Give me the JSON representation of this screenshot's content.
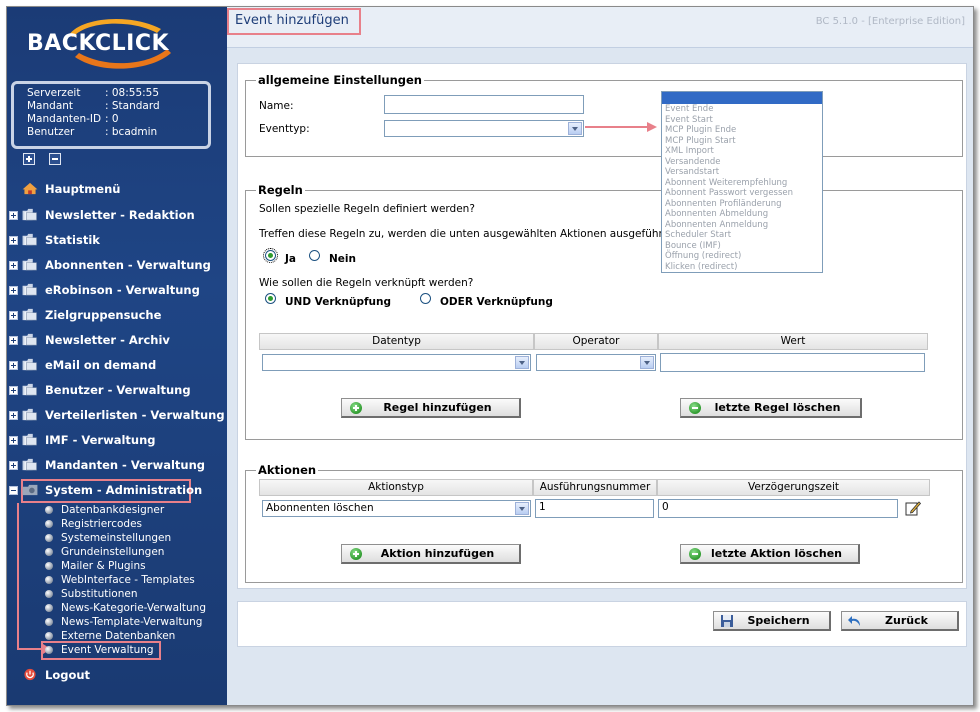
{
  "brand": {
    "logo_text": "BACKCLICK"
  },
  "info": {
    "rows": [
      {
        "key": "Serverzeit",
        "value": ": 08:55:55"
      },
      {
        "key": "Mandant",
        "value": ": Standard"
      },
      {
        "key": "Mandanten-ID",
        "value": ": 0"
      },
      {
        "key": "Benutzer",
        "value": ": bcadmin"
      }
    ]
  },
  "nav": {
    "items": [
      {
        "label": "Hauptmenü"
      },
      {
        "label": "Newsletter - Redaktion"
      },
      {
        "label": "Statistik"
      },
      {
        "label": "Abonnenten - Verwaltung"
      },
      {
        "label": "eRobinson - Verwaltung"
      },
      {
        "label": "Zielgruppensuche"
      },
      {
        "label": "Newsletter - Archiv"
      },
      {
        "label": "eMail on demand"
      },
      {
        "label": "Benutzer - Verwaltung"
      },
      {
        "label": "Verteilerlisten - Verwaltung"
      },
      {
        "label": "IMF - Verwaltung"
      },
      {
        "label": "Mandanten - Verwaltung"
      },
      {
        "label": "System - Administration"
      }
    ],
    "sub_items": [
      {
        "label": "Datenbankdesigner"
      },
      {
        "label": "Registriercodes"
      },
      {
        "label": "Systemeinstellungen"
      },
      {
        "label": "Grundeinstellungen"
      },
      {
        "label": "Mailer & Plugins"
      },
      {
        "label": "WebInterface - Templates"
      },
      {
        "label": "Substitutionen"
      },
      {
        "label": "News-Kategorie-Verwaltung"
      },
      {
        "label": "News-Template-Verwaltung"
      },
      {
        "label": "Externe Datenbanken"
      },
      {
        "label": "Event Verwaltung"
      }
    ],
    "logout": "Logout"
  },
  "header": {
    "title": "Event hinzufügen",
    "version": "BC 5.1.0 - [Enterprise Edition]"
  },
  "general": {
    "legend": "allgemeine Einstellungen",
    "name_label": "Name:",
    "name_value": "",
    "eventtype_label": "Eventtyp:",
    "eventtype_value": "",
    "eventtype_options": [
      "Event Ende",
      "Event Start",
      "MCP Plugin Ende",
      "MCP Plugin Start",
      "XML Import",
      "Versandende",
      "Versandstart",
      "Abonnent Weiterempfehlung",
      "Abonnent Passwort vergessen",
      "Abonnenten Profiländerung",
      "Abonnenten Abmeldung",
      "Abonnenten Anmeldung",
      "Scheduler Start",
      "Bounce (IMF)",
      "Öffnung (redirect)",
      "Klicken (redirect)"
    ]
  },
  "rules": {
    "legend": "Regeln",
    "question1": "Sollen spezielle Regeln definiert werden?",
    "info": "Treffen diese Regeln zu, werden die unten ausgewählten Aktionen ausgeführt.",
    "yes": "Ja",
    "no": "Nein",
    "question2": "Wie sollen die Regeln verknüpft werden?",
    "and": "UND Verknüpfung",
    "or": "ODER Verknüpfung",
    "columns": [
      "Datentyp",
      "Operator",
      "Wert"
    ],
    "row": {
      "datatype": "",
      "operator": "",
      "value": ""
    },
    "add_button": "Regel hinzufügen",
    "delete_button": "letzte Regel löschen"
  },
  "actions": {
    "legend": "Aktionen",
    "columns": [
      "Aktionstyp",
      "Ausführungsnummer",
      "Verzögerungszeit"
    ],
    "row": {
      "type": "Abonnenten löschen",
      "number": "1",
      "delay": "0"
    },
    "add_button": "Aktion hinzufügen",
    "delete_button": "letzte Aktion löschen"
  },
  "footer": {
    "save": "Speichern",
    "back": "Zurück"
  }
}
